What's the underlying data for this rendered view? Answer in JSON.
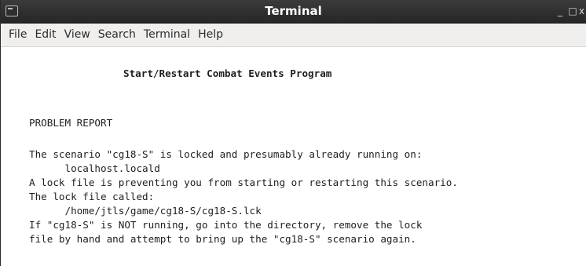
{
  "window": {
    "title": "Terminal",
    "minimize": "_",
    "maximize": "□",
    "close": "x"
  },
  "menu": {
    "items": [
      "File",
      "Edit",
      "View",
      "Search",
      "Terminal",
      "Help"
    ]
  },
  "terminal": {
    "heading": "Start/Restart Combat Events Program",
    "section_title": "PROBLEM REPORT",
    "lines": [
      "The scenario \"cg18-S\" is locked and presumably already running on:",
      "      localhost.locald",
      "A lock file is preventing you from starting or restarting this scenario.",
      "The lock file called:",
      "      /home/jtls/game/cg18-S/cg18-S.lck",
      "If \"cg18-S\" is NOT running, go into the directory, remove the lock",
      "file by hand and attempt to bring up the \"cg18-S\" scenario again."
    ]
  }
}
